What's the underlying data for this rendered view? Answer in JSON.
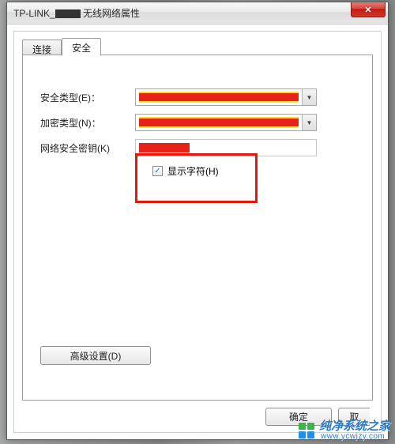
{
  "window": {
    "title_prefix": "TP-LINK_",
    "title_suffix": " 无线网络属性",
    "close_glyph": "✕"
  },
  "tabs": {
    "connect": "连接",
    "security": "安全"
  },
  "form": {
    "security_type_label": "安全类型(E)：",
    "encryption_type_label": "加密类型(N)：",
    "key_label": "网络安全密钥(K)",
    "show_chars_label": "显示字符(H)",
    "show_chars_checked": true,
    "dropdown_glyph": "▼",
    "check_glyph": "✓"
  },
  "buttons": {
    "advanced": "高级设置(D)",
    "ok": "确定",
    "cancel_partial": "取"
  },
  "watermark": {
    "brand": "纯净系统之家",
    "url": "www.ycwjzy.com",
    "colors": [
      "#3bb44a",
      "#3bb44a",
      "#1f8fe8",
      "#1f8fe8"
    ]
  }
}
